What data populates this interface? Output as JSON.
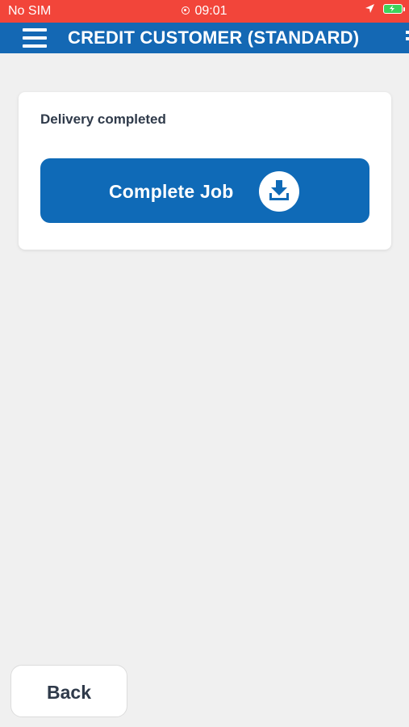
{
  "status_bar": {
    "carrier": "No SIM",
    "time": "09:01",
    "icons": [
      "screen-record-icon",
      "location-arrow-icon",
      "battery-charging-icon"
    ],
    "background_color": "#f2453a"
  },
  "header": {
    "title": "CREDIT CUSTOMER (STANDARD)",
    "menu_icon": "hamburger-menu-icon",
    "more_icon": "more-icon",
    "background_color": "#1468b4"
  },
  "card": {
    "status_label": "Delivery completed",
    "complete_button": {
      "label": "Complete Job",
      "icon": "download-tray-icon",
      "background_color": "#0f6ab7"
    }
  },
  "footer": {
    "back_label": "Back"
  }
}
